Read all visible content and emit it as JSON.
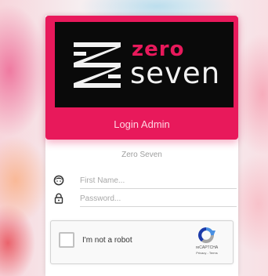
{
  "brand": {
    "logo_word_1": "zero",
    "logo_word_2": "seven",
    "accent_color": "#e8195b"
  },
  "header": {
    "title": "Login Admin"
  },
  "subtitle": "Zero Seven",
  "form": {
    "first_name": {
      "placeholder": "First Name...",
      "value": "",
      "icon": "face-icon"
    },
    "password": {
      "placeholder": "Password...",
      "value": "",
      "icon": "lock-icon"
    }
  },
  "recaptcha": {
    "label": "I'm not a robot",
    "brand": "reCAPTCHA",
    "privacy": "Privacy",
    "terms": "Terms",
    "separator": " - "
  }
}
